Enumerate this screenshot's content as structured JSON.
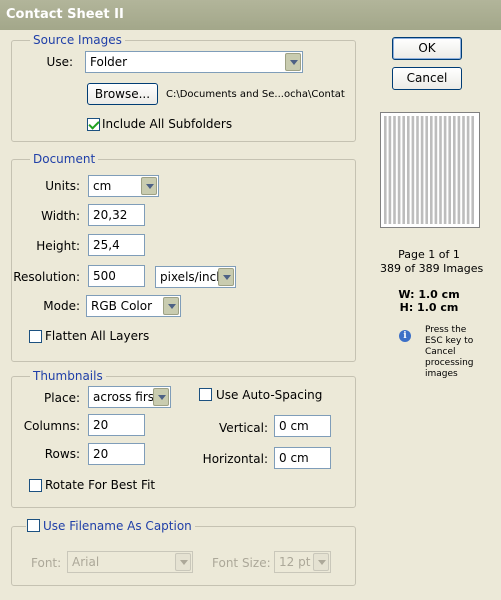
{
  "window": {
    "title": "Contact Sheet II"
  },
  "buttons": {
    "ok": "OK",
    "cancel": "Cancel"
  },
  "source_images": {
    "legend": "Source Images",
    "use_label": "Use:",
    "use_value": "Folder",
    "browse_label": "Browse...",
    "path": "C:\\Documents and Se...ocha\\Contat Sheet\\",
    "include_subfolders_label": "Include All Subfolders",
    "include_subfolders_checked": true
  },
  "document": {
    "legend": "Document",
    "units_label": "Units:",
    "units_value": "cm",
    "width_label": "Width:",
    "width_value": "20,32",
    "height_label": "Height:",
    "height_value": "25,4",
    "resolution_label": "Resolution:",
    "resolution_value": "500",
    "resolution_unit": "pixels/inch",
    "mode_label": "Mode:",
    "mode_value": "RGB Color",
    "flatten_label": "Flatten All Layers",
    "flatten_checked": false
  },
  "thumbnails": {
    "legend": "Thumbnails",
    "place_label": "Place:",
    "place_value": "across first",
    "columns_label": "Columns:",
    "columns_value": "20",
    "rows_label": "Rows:",
    "rows_value": "20",
    "auto_spacing_label": "Use Auto-Spacing",
    "auto_spacing_checked": false,
    "vertical_label": "Vertical:",
    "vertical_value": "0 cm",
    "horizontal_label": "Horizontal:",
    "horizontal_value": "0 cm",
    "rotate_label": "Rotate For Best Fit",
    "rotate_checked": false
  },
  "caption": {
    "use_filename_label": "Use Filename As Caption",
    "use_filename_checked": false,
    "font_label": "Font:",
    "font_value": "Arial",
    "font_size_label": "Font Size:",
    "font_size_value": "12 pt"
  },
  "preview_info": {
    "page": "Page 1 of 1",
    "images": "389 of 389 Images",
    "w": "W: 1.0 cm",
    "h": "H: 1.0 cm",
    "esc_note": [
      "Press the",
      "ESC key to",
      "Cancel",
      "processing",
      "images"
    ],
    "info_icon": "info-icon"
  },
  "colors": {
    "titlebar": "#A8AB8E",
    "legend_text": "#1F3FA8",
    "dialog_bg": "#ECE9D8",
    "preview_stripe": "#BDBDBD"
  }
}
